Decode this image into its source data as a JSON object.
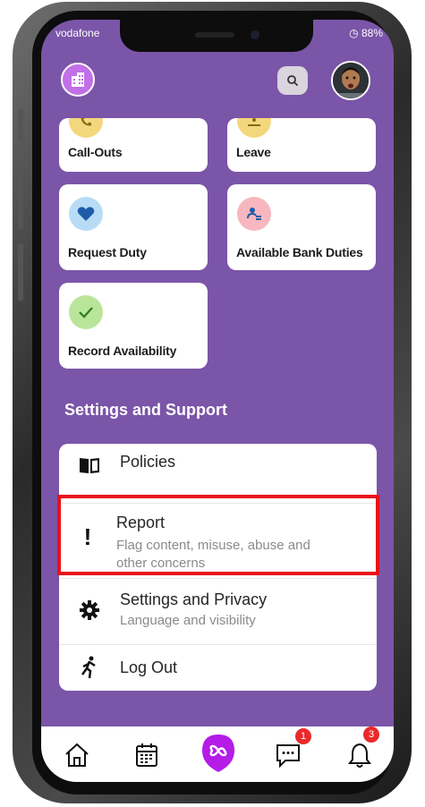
{
  "status_bar": {
    "carrier": "vodafone",
    "battery": "88%"
  },
  "header": {
    "logo_icon": "building-icon",
    "search_icon": "search-icon",
    "avatar_icon": "user-avatar"
  },
  "cards": [
    {
      "label": "Call-Outs",
      "icon": "phone-icon",
      "color": "#f3d77c"
    },
    {
      "label": "Leave",
      "icon": "beach-icon",
      "color": "#f3d77c"
    },
    {
      "label": "Request Duty",
      "icon": "heart-icon",
      "color": "#b9dcf6"
    },
    {
      "label": "Available Bank Duties",
      "icon": "people-icon",
      "color": "#f7b7bf"
    },
    {
      "label": "Record Availability",
      "icon": "check-icon",
      "color": "#b9e59a"
    }
  ],
  "section": {
    "title": "Settings and Support"
  },
  "menu": {
    "policies": {
      "title": "Policies",
      "icon": "book-icon"
    },
    "report": {
      "title": "Report",
      "subtitle_line1": "Flag content, misuse, abuse and",
      "subtitle_line2": "other concerns",
      "icon": "exclamation-icon"
    },
    "settings": {
      "title": "Settings and Privacy",
      "subtitle": "Language and visibility",
      "icon": "gear-icon"
    },
    "logout": {
      "title": "Log Out",
      "icon": "running-person-icon"
    }
  },
  "tabbar": {
    "items": [
      {
        "icon": "home-icon"
      },
      {
        "icon": "calendar-icon"
      },
      {
        "icon": "app-infinity-icon",
        "color": "#b51ce8"
      },
      {
        "icon": "chat-icon",
        "badge": "1"
      },
      {
        "icon": "bell-icon",
        "badge": "3"
      }
    ]
  },
  "colors": {
    "background": "#7b55a8",
    "highlight": "#e8121a"
  }
}
